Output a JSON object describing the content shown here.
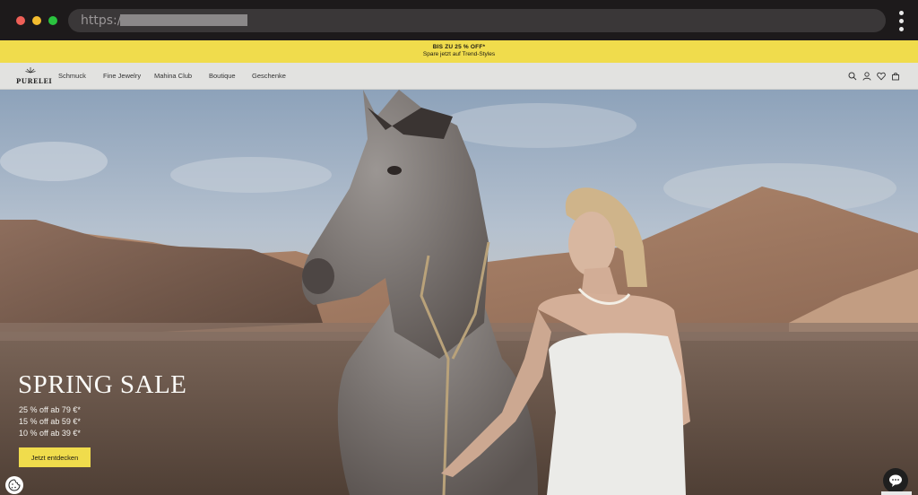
{
  "browser": {
    "url_prefix": "https://"
  },
  "promo": {
    "title": "BIS ZU 25 % OFF*",
    "subtitle": "Spare jetzt auf Trend-Styles",
    "background": "#f0dc4c"
  },
  "nav": {
    "logo": "PURELEI",
    "links": [
      {
        "label": "Schmuck"
      },
      {
        "label": "Fine Jewelry"
      },
      {
        "label": "Mahina Club"
      },
      {
        "label": "Boutique"
      },
      {
        "label": "Geschenke"
      }
    ],
    "icons": [
      "search-icon",
      "account-icon",
      "wishlist-heart-icon",
      "cart-bag-icon"
    ]
  },
  "hero": {
    "title": "SPRING SALE",
    "offers": [
      "25 % off ab 79 €*",
      "15 % off ab 59 €*",
      "10 % off ab 39 €*"
    ],
    "cta_label": "Jetzt entdecken",
    "accent": "#f0dc4c"
  }
}
